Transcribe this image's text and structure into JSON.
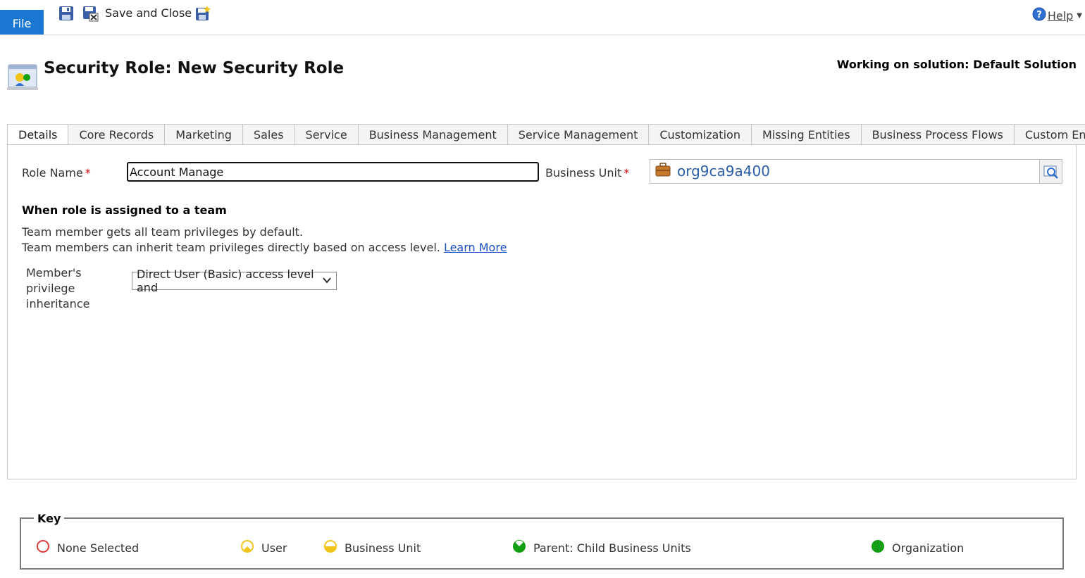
{
  "ribbon": {
    "file_label": "File",
    "save_close_label": "Save and Close",
    "help_label": "Help"
  },
  "header": {
    "title": "Security Role: New Security Role",
    "solution": "Working on solution: Default Solution"
  },
  "tabs": [
    {
      "label": "Details",
      "active": true
    },
    {
      "label": "Core Records"
    },
    {
      "label": "Marketing"
    },
    {
      "label": "Sales"
    },
    {
      "label": "Service"
    },
    {
      "label": "Business Management"
    },
    {
      "label": "Service Management"
    },
    {
      "label": "Customization"
    },
    {
      "label": "Missing Entities"
    },
    {
      "label": "Business Process Flows"
    },
    {
      "label": "Custom Entities"
    }
  ],
  "form": {
    "role_name_label": "Role Name",
    "role_name_value": "Account Manage",
    "business_unit_label": "Business Unit",
    "business_unit_value": "org9ca9a400",
    "required_mark": "*",
    "team_section_title": "When role is assigned to a team",
    "team_desc_1": "Team member gets all team privileges by default.",
    "team_desc_2": "Team members can inherit team privileges directly based on access level.",
    "learn_more": "Learn More",
    "inheritance_label": "Member's privilege inheritance",
    "inheritance_value": "Direct User (Basic) access level and"
  },
  "key": {
    "title": "Key",
    "items": [
      {
        "label": "None Selected",
        "icon": "circle-empty-red-icon"
      },
      {
        "label": "User",
        "icon": "circle-quarter-yellow-icon"
      },
      {
        "label": "Business Unit",
        "icon": "circle-half-yellow-icon"
      },
      {
        "label": "Parent: Child Business Units",
        "icon": "circle-three-quarter-green-icon"
      },
      {
        "label": "Organization",
        "icon": "circle-full-green-icon"
      }
    ]
  },
  "colors": {
    "file_button": "#1a78d2",
    "link": "#1a4fc4",
    "required": "#d40000",
    "none_selected": "#e23b3b",
    "user_bu": "#f0c419",
    "org": "#14a014"
  }
}
